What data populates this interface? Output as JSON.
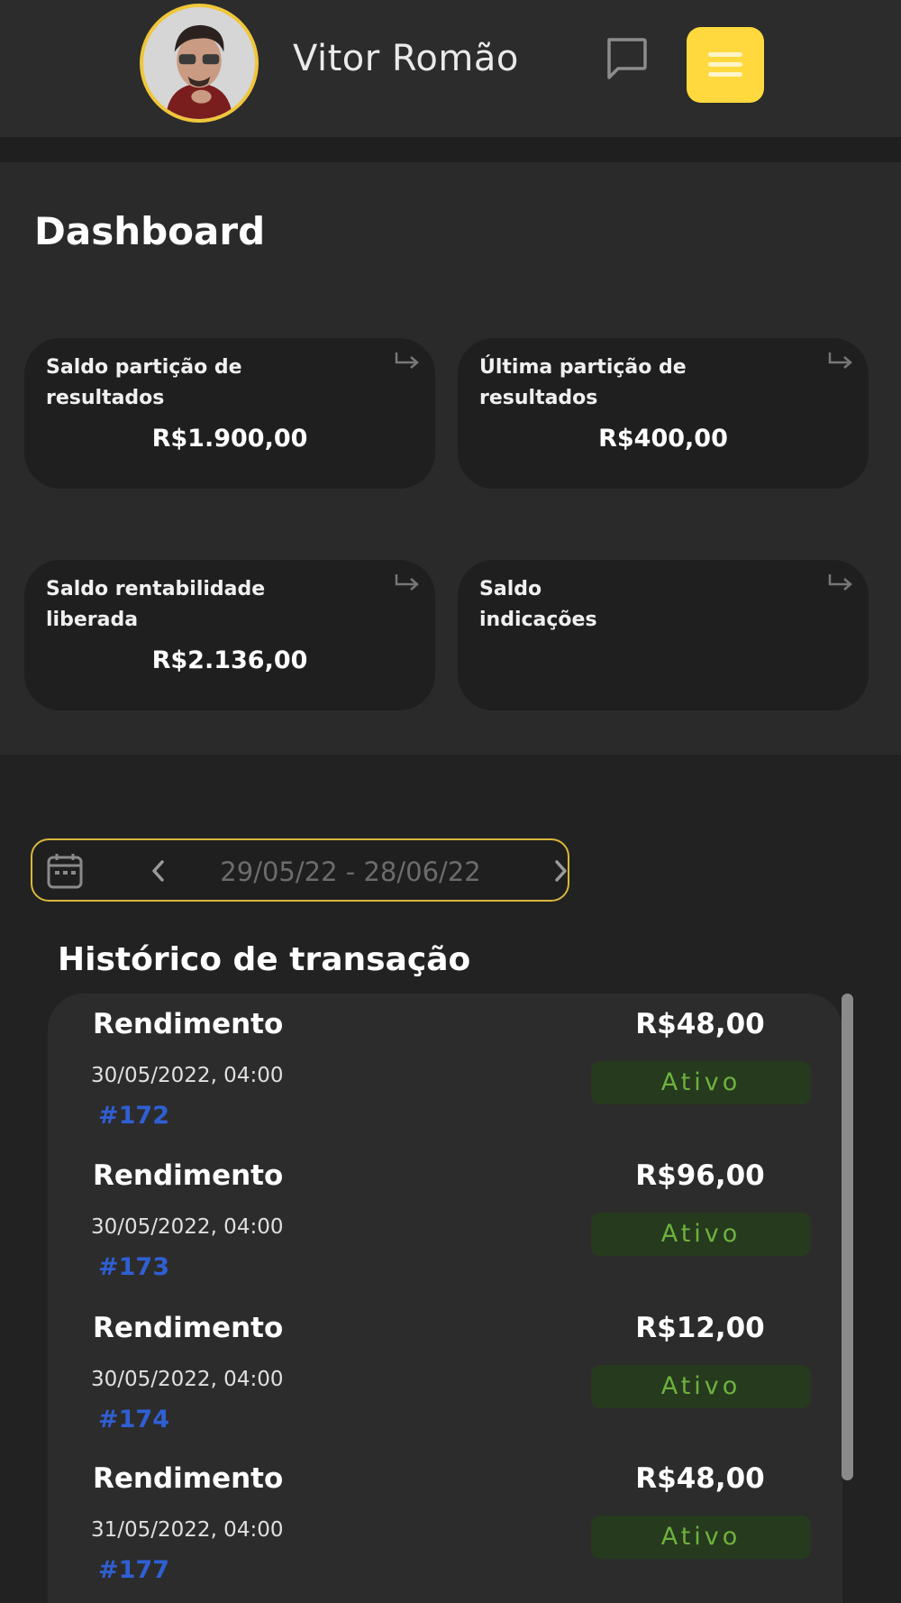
{
  "header": {
    "user_name": "Vitor Romão",
    "icons": {
      "chat": "chat-bubble-icon",
      "menu": "hamburger-menu-icon"
    },
    "accent_color": "#ffd93d"
  },
  "dashboard": {
    "title": "Dashboard",
    "cards": [
      {
        "title": "Saldo partição de resultados",
        "value": "R$1.900,00"
      },
      {
        "title": "Última partição de resultados",
        "value": "R$400,00"
      },
      {
        "title": "Saldo rentabilidade liberada",
        "value": "R$2.136,00"
      },
      {
        "title": "Saldo indicações",
        "value": ""
      }
    ]
  },
  "date_filter": {
    "range": "29/05/22 - 28/06/22"
  },
  "transactions": {
    "title": "Histórico de transação",
    "items": [
      {
        "type": "Rendimento",
        "amount": "R$48,00",
        "date": "30/05/2022, 04:00",
        "id": "#172",
        "status": "Ativo"
      },
      {
        "type": "Rendimento",
        "amount": "R$96,00",
        "date": "30/05/2022, 04:00",
        "id": "#173",
        "status": "Ativo"
      },
      {
        "type": "Rendimento",
        "amount": "R$12,00",
        "date": "30/05/2022, 04:00",
        "id": "#174",
        "status": "Ativo"
      },
      {
        "type": "Rendimento",
        "amount": "R$48,00",
        "date": "31/05/2022, 04:00",
        "id": "#177",
        "status": "Ativo"
      }
    ],
    "status_color": "#6eb23e",
    "id_color": "#2f5fd3"
  }
}
